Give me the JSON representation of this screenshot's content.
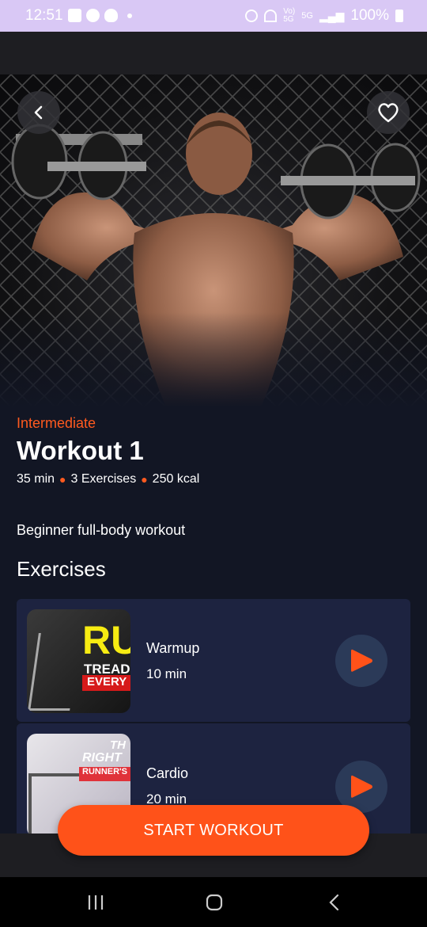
{
  "status_bar": {
    "time": "12:51",
    "battery": "100%",
    "network": "5G"
  },
  "hero": {
    "back_icon": "chevron-left-icon",
    "favorite_icon": "heart-icon"
  },
  "workout": {
    "level": "Intermediate",
    "title": "Workout 1",
    "duration": "35 min",
    "exercises_count": "3 Exercises",
    "calories": "250 kcal",
    "description": "Beginner full-body workout"
  },
  "exercises_section": {
    "heading": "Exercises",
    "items": [
      {
        "name": "Warmup",
        "duration": "10 min",
        "thumb_text": [
          "RU",
          "TREADM",
          "EVERY"
        ]
      },
      {
        "name": "Cardio",
        "duration": "20 min",
        "thumb_text": [
          "TH",
          "RIGHT",
          "RUNNER'S"
        ]
      }
    ]
  },
  "actions": {
    "start_label": "START WORKOUT"
  },
  "colors": {
    "accent": "#ff5219",
    "background": "#121624",
    "card": "#1d2340"
  }
}
